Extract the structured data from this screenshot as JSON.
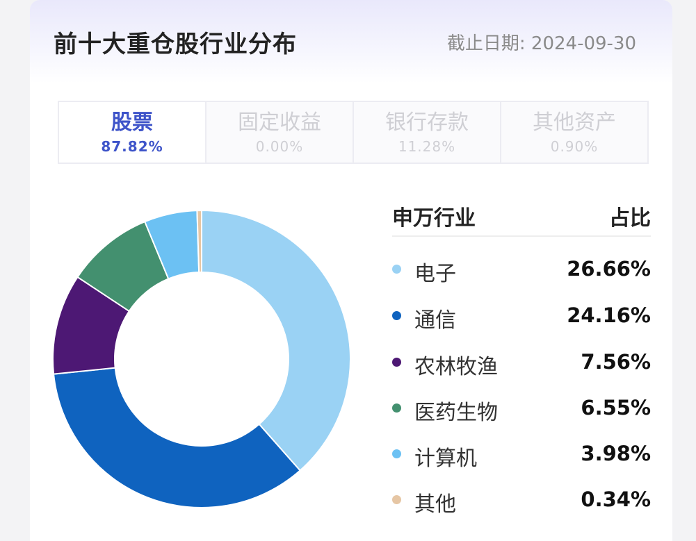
{
  "header": {
    "title": "前十大重仓股行业分布",
    "date": "截止日期: 2024-09-30"
  },
  "tabs": [
    {
      "label": "股票",
      "percent": "87.82%",
      "active": true
    },
    {
      "label": "固定收益",
      "percent": "0.00%",
      "active": false
    },
    {
      "label": "银行存款",
      "percent": "11.28%",
      "active": false
    },
    {
      "label": "其他资产",
      "percent": "0.90%",
      "active": false
    }
  ],
  "legend_header": {
    "industry": "申万行业",
    "ratio": "占比"
  },
  "chart_data": {
    "type": "pie",
    "variant": "donut",
    "categories": [
      "电子",
      "通信",
      "农林牧渔",
      "医药生物",
      "计算机",
      "其他"
    ],
    "values": [
      26.66,
      24.16,
      7.56,
      6.55,
      3.98,
      0.34
    ],
    "labels": [
      "26.66%",
      "24.16%",
      "7.56%",
      "6.55%",
      "3.98%",
      "0.34%"
    ],
    "colors": [
      "#9ad2f4",
      "#0f63bf",
      "#4d1874",
      "#43906f",
      "#6cc1f3",
      "#e6c6a4"
    ],
    "legend": "right"
  }
}
